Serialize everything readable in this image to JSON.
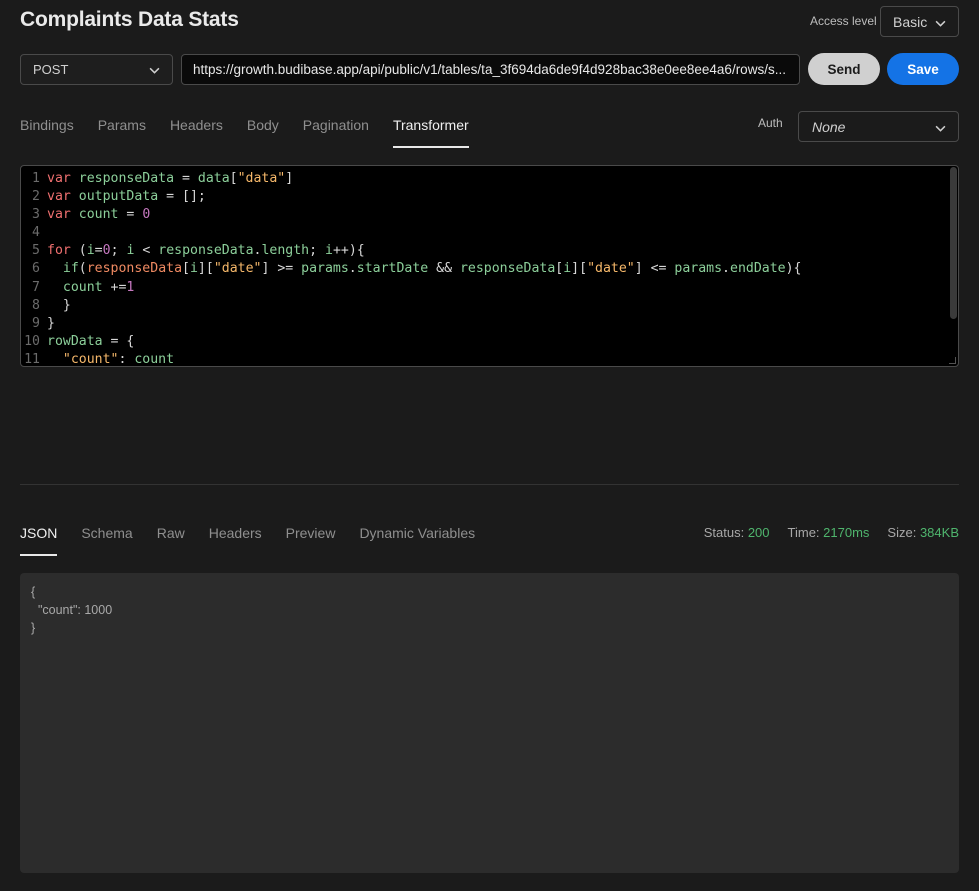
{
  "header": {
    "title": "Complaints Data Stats",
    "access_level_label": "Access level",
    "access_level_value": "Basic"
  },
  "request": {
    "method": "POST",
    "url": "https://growth.budibase.app/api/public/v1/tables/ta_3f694da6de9f4d928bac38e0ee8ee4a6/rows/s...",
    "send_label": "Send",
    "save_label": "Save"
  },
  "request_tabs": [
    {
      "label": "Bindings",
      "active": false
    },
    {
      "label": "Params",
      "active": false
    },
    {
      "label": "Headers",
      "active": false
    },
    {
      "label": "Body",
      "active": false
    },
    {
      "label": "Pagination",
      "active": false
    },
    {
      "label": "Transformer",
      "active": true
    }
  ],
  "auth": {
    "label": "Auth",
    "value": "None"
  },
  "editor": {
    "lines": [
      [
        [
          "kw",
          "var"
        ],
        [
          "pl",
          " "
        ],
        [
          "id",
          "responseData"
        ],
        [
          "pl",
          " = "
        ],
        [
          "id",
          "data"
        ],
        [
          "pl",
          "["
        ],
        [
          "str",
          "\"data\""
        ],
        [
          "pl",
          "]"
        ]
      ],
      [
        [
          "kw",
          "var"
        ],
        [
          "pl",
          " "
        ],
        [
          "id",
          "outputData"
        ],
        [
          "pl",
          " = [];"
        ]
      ],
      [
        [
          "kw",
          "var"
        ],
        [
          "pl",
          " "
        ],
        [
          "id",
          "count"
        ],
        [
          "pl",
          " = "
        ],
        [
          "num",
          "0"
        ]
      ],
      [],
      [
        [
          "kw",
          "for"
        ],
        [
          "pl",
          " ("
        ],
        [
          "id",
          "i"
        ],
        [
          "pl",
          "="
        ],
        [
          "num",
          "0"
        ],
        [
          "pl",
          "; "
        ],
        [
          "id",
          "i"
        ],
        [
          "pl",
          " < "
        ],
        [
          "id",
          "responseData"
        ],
        [
          "pl",
          "."
        ],
        [
          "id",
          "length"
        ],
        [
          "pl",
          "; "
        ],
        [
          "id",
          "i"
        ],
        [
          "pl",
          "++){"
        ]
      ],
      [
        [
          "pl",
          "  "
        ],
        [
          "id",
          "if"
        ],
        [
          "pl",
          "("
        ],
        [
          "var2",
          "responseData"
        ],
        [
          "pl",
          "["
        ],
        [
          "id",
          "i"
        ],
        [
          "pl",
          "]["
        ],
        [
          "str",
          "\"date\""
        ],
        [
          "pl",
          "] >= "
        ],
        [
          "id",
          "params"
        ],
        [
          "pl",
          "."
        ],
        [
          "id",
          "startDate"
        ],
        [
          "pl",
          " && "
        ],
        [
          "id",
          "responseData"
        ],
        [
          "pl",
          "["
        ],
        [
          "id",
          "i"
        ],
        [
          "pl",
          "]["
        ],
        [
          "str",
          "\"date\""
        ],
        [
          "pl",
          "] <= "
        ],
        [
          "id",
          "params"
        ],
        [
          "pl",
          "."
        ],
        [
          "id",
          "endDate"
        ],
        [
          "pl",
          "){"
        ]
      ],
      [
        [
          "pl",
          "  "
        ],
        [
          "id",
          "count"
        ],
        [
          "pl",
          " +="
        ],
        [
          "num",
          "1"
        ]
      ],
      [
        [
          "pl",
          "  }"
        ]
      ],
      [
        [
          "pl",
          "}"
        ]
      ],
      [
        [
          "id",
          "rowData"
        ],
        [
          "pl",
          " = {"
        ]
      ],
      [
        [
          "pl",
          "  "
        ],
        [
          "str",
          "\"count\""
        ],
        [
          "pl",
          ": "
        ],
        [
          "id",
          "count"
        ]
      ]
    ]
  },
  "response_tabs": [
    {
      "label": "JSON",
      "active": true
    },
    {
      "label": "Schema",
      "active": false
    },
    {
      "label": "Raw",
      "active": false
    },
    {
      "label": "Headers",
      "active": false
    },
    {
      "label": "Preview",
      "active": false
    },
    {
      "label": "Dynamic Variables",
      "active": false
    }
  ],
  "stats": [
    {
      "label": "Status:",
      "value": "200"
    },
    {
      "label": "Time:",
      "value": "2170ms"
    },
    {
      "label": "Size:",
      "value": "384KB"
    }
  ],
  "response": {
    "body": "{\n  \"count\": 1000\n}"
  },
  "colors": {
    "accent": "#1473e6",
    "status_ok": "#4fb56d",
    "background": "#1b1b1b"
  }
}
